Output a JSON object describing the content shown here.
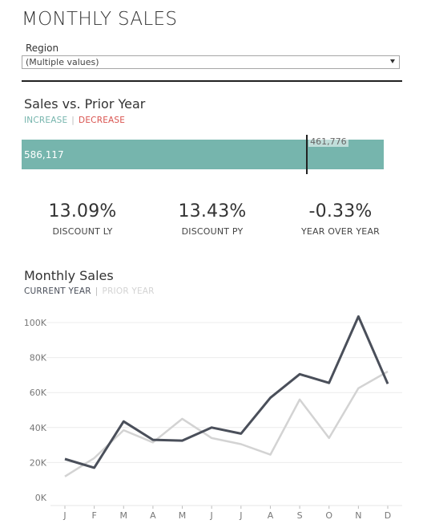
{
  "page": {
    "title": "MONTHLY SALES"
  },
  "filter": {
    "label": "Region",
    "value": "(Multiple values)"
  },
  "sales_vs_prior": {
    "title": "Sales vs. Prior Year",
    "legend": {
      "increase": "INCREASE",
      "decrease": "DECREASE"
    },
    "colors": {
      "increase": "#76b5ad",
      "decrease": "#d9534f"
    },
    "current_value": 586117,
    "current_label": "586,117",
    "prior_value": 461776,
    "prior_label": "461,776"
  },
  "kpis": [
    {
      "value": "13.09%",
      "label": "DISCOUNT LY"
    },
    {
      "value": "13.43%",
      "label": "DISCOUNT PY"
    },
    {
      "value": "-0.33%",
      "label": "YEAR OVER YEAR"
    }
  ],
  "monthly": {
    "title": "Monthly Sales",
    "legend": {
      "current": "CURRENT YEAR",
      "prior": "PRIOR YEAR"
    },
    "colors": {
      "current": "#4a4f5a",
      "prior": "#d3d3d3",
      "grid": "#ececec",
      "axis_text": "#777777"
    }
  },
  "chart_data": {
    "type": "line",
    "title": "Monthly Sales",
    "categories": [
      "J",
      "F",
      "M",
      "A",
      "M",
      "J",
      "J",
      "A",
      "S",
      "O",
      "N",
      "D"
    ],
    "yticks": [
      "100K",
      "80K",
      "60K",
      "40K",
      "20K",
      "0K"
    ],
    "ytick_values": [
      100000,
      80000,
      60000,
      40000,
      20000,
      0
    ],
    "ylim": [
      0,
      100000
    ],
    "grid": true,
    "series": [
      {
        "name": "CURRENT YEAR",
        "key": "current",
        "values": [
          22000,
          17000,
          43500,
          33000,
          32500,
          40000,
          36500,
          57000,
          70500,
          65500,
          103500,
          65000
        ]
      },
      {
        "name": "PRIOR YEAR",
        "key": "prior",
        "values": [
          12000,
          22500,
          38500,
          31500,
          45000,
          34000,
          30500,
          24500,
          56000,
          34000,
          62500,
          72000
        ]
      }
    ]
  }
}
